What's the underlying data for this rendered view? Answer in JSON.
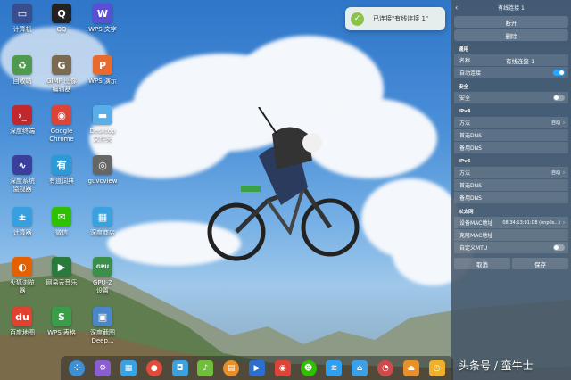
{
  "desktop_icons": [
    {
      "label": "计算机",
      "icon": "computer-icon",
      "color": "#3a4d8f",
      "glyph": "▭"
    },
    {
      "label": "QQ",
      "icon": "qq-penguin-icon",
      "color": "#222222",
      "glyph": "Q"
    },
    {
      "label": "WPS 文字",
      "icon": "wps-writer-icon",
      "color": "#5b4fd6",
      "glyph": "W"
    },
    {
      "label": "回收站",
      "icon": "trash-icon",
      "color": "#4e9a4e",
      "glyph": "♻"
    },
    {
      "label": "GIMP 图像\n编辑器",
      "icon": "gimp-icon",
      "color": "#7a6a50",
      "glyph": "G"
    },
    {
      "label": "WPS 演示",
      "icon": "wps-presentation-icon",
      "color": "#e86b2d",
      "glyph": "P"
    },
    {
      "label": "深度终端",
      "icon": "terminal-icon",
      "color": "#c0282d",
      "glyph": "›_"
    },
    {
      "label": "Google\nChrome",
      "icon": "chrome-icon",
      "color": "#db4437",
      "glyph": "◉"
    },
    {
      "label": "Desktop\n文件夹",
      "icon": "folder-icon",
      "color": "#5aaee8",
      "glyph": "▬"
    },
    {
      "label": "深度系统\n监视器",
      "icon": "system-monitor-icon",
      "color": "#3b3f9b",
      "glyph": "∿"
    },
    {
      "label": "有道词典",
      "icon": "youdao-dict-icon",
      "color": "#2b9bd7",
      "glyph": "有"
    },
    {
      "label": "guvcview",
      "icon": "webcam-icon",
      "color": "#666666",
      "glyph": "◎"
    },
    {
      "label": "计算器",
      "icon": "calculator-icon",
      "color": "#38a0e0",
      "glyph": "±"
    },
    {
      "label": "微信",
      "icon": "wechat-icon",
      "color": "#2dc100",
      "glyph": "✉"
    },
    {
      "label": "深度商店",
      "icon": "app-store-icon",
      "color": "#3aa2e0",
      "glyph": "▦"
    },
    {
      "label": "火狐浏览\n器",
      "icon": "firefox-icon",
      "color": "#e66000",
      "glyph": "◐"
    },
    {
      "label": "网易云音乐",
      "icon": "netease-music-icon",
      "color": "#2b7a3d",
      "glyph": "▶"
    },
    {
      "label": "GPU-Z\n设置",
      "icon": "gpu-icon",
      "color": "#3a8f4a",
      "glyph": "GPU"
    },
    {
      "label": "百度地图",
      "icon": "baidu-map-icon",
      "color": "#e3412f",
      "glyph": "du"
    },
    {
      "label": "WPS 表格",
      "icon": "wps-spreadsheet-icon",
      "color": "#3a9d4a",
      "glyph": "S"
    },
    {
      "label": "深度截图\nDeep...",
      "icon": "screenshot-icon",
      "color": "#4a86c8",
      "glyph": "▣"
    }
  ],
  "notification": {
    "text": "已连接\"有线连接 1\"",
    "icon": "check-icon"
  },
  "panel": {
    "title": "有线连接 1",
    "disconnect": "断开",
    "delete": "删除",
    "general": {
      "heading": "通用",
      "name_label": "名称",
      "name_value": "有线连接 1",
      "autoconnect_label": "自动连接",
      "autoconnect": true
    },
    "security": {
      "heading": "安全",
      "label": "安全",
      "enabled": false
    },
    "ipv4": {
      "heading": "IPv4",
      "method_label": "方法",
      "method_value": "自动",
      "dns1": "首选DNS",
      "dns2": "备用DNS"
    },
    "ipv6": {
      "heading": "IPv6",
      "method_label": "方法",
      "method_value": "自动",
      "dns1": "首选DNS",
      "dns2": "备用DNS"
    },
    "ethernet": {
      "heading": "以太网",
      "mac_label": "设备MAC地址",
      "mac_value": "08:34:13:91:D8 (enp0s...)",
      "clone_label": "克隆MAC地址",
      "mtu_label": "自定义MTU",
      "mtu_enabled": false
    },
    "cancel": "取消",
    "save": "保存"
  },
  "dock": [
    {
      "icon": "launcher-icon",
      "color": "#3d8fd6",
      "glyph": "⁘"
    },
    {
      "icon": "settings-gear-icon",
      "color": "#8a5ed1",
      "glyph": "⚙"
    },
    {
      "icon": "multitask-view-icon",
      "color": "#3aa2e0",
      "glyph": "▦"
    },
    {
      "icon": "screen-record-icon",
      "color": "#e04b3a",
      "glyph": "●"
    },
    {
      "icon": "app-store-icon",
      "color": "#3aa2e0",
      "glyph": "◘"
    },
    {
      "icon": "music-player-icon",
      "color": "#6fbf3a",
      "glyph": "♪"
    },
    {
      "icon": "file-manager-icon",
      "color": "#e88f2a",
      "glyph": "▤"
    },
    {
      "icon": "video-player-icon",
      "color": "#2b6fd1",
      "glyph": "▶"
    },
    {
      "icon": "chrome-icon",
      "color": "#db4437",
      "glyph": "◉"
    },
    {
      "icon": "wechat-icon",
      "color": "#2dc100",
      "glyph": "☻"
    },
    {
      "icon": "wifi-network-icon",
      "color": "#2fa0f0",
      "glyph": "≋"
    },
    {
      "icon": "image-viewer-icon",
      "color": "#3ba0e8",
      "glyph": "⌂"
    },
    {
      "icon": "system-monitor-icon",
      "color": "#d14a4a",
      "glyph": "◔"
    },
    {
      "icon": "eject-icon",
      "color": "#e8902a",
      "glyph": "⏏"
    },
    {
      "icon": "clock-icon",
      "color": "#f0b02a",
      "glyph": "◷"
    }
  ],
  "watermark": "头条号 / 蛮牛士"
}
